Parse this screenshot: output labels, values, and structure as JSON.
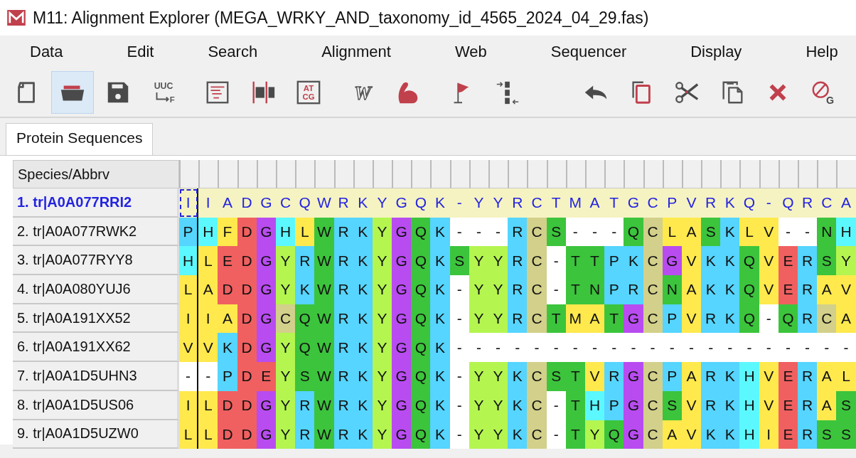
{
  "window": {
    "title": "M11: Alignment Explorer (MEGA_WRKY_AND_taxonomy_id_4565_2024_04_29.fas)"
  },
  "menu": [
    "Data",
    "Edit",
    "Search",
    "Alignment",
    "Web",
    "Sequencer",
    "Display",
    "Help"
  ],
  "toolbar": [
    [
      {
        "kind": "new",
        "active": false
      },
      {
        "kind": "open",
        "active": true
      },
      {
        "kind": "save",
        "active": false
      },
      {
        "kind": "translate",
        "active": false,
        "label": "UUC",
        "sublabel": "F"
      }
    ],
    [
      {
        "kind": "text",
        "active": false
      },
      {
        "kind": "split",
        "active": false
      },
      {
        "kind": "bases",
        "active": false,
        "label": "AT",
        "sublabel": "CG"
      }
    ],
    [
      {
        "kind": "wletter",
        "active": false,
        "label": "W"
      },
      {
        "kind": "arm",
        "active": false
      }
    ],
    [
      {
        "kind": "flag",
        "active": false
      },
      {
        "kind": "mark",
        "active": false
      },
      {
        "kind": "undo",
        "active": false
      },
      {
        "kind": "copy",
        "active": false
      },
      {
        "kind": "cut",
        "active": false
      },
      {
        "kind": "paste",
        "active": false
      },
      {
        "kind": "delete",
        "active": false
      },
      {
        "kind": "gaps",
        "active": false,
        "label": "G"
      }
    ]
  ],
  "tabs": [
    {
      "label": "Protein Sequences",
      "selected": true
    }
  ],
  "table": {
    "name_header": "Species/Abbrv",
    "rows": [
      {
        "name": "1. tr|A0A077RRI2",
        "selected": true,
        "cursor_at_start": true,
        "cells": [
          {
            "aa": "I"
          },
          {
            "aa": "I"
          },
          {
            "aa": "A"
          },
          {
            "aa": "D"
          },
          {
            "aa": "G"
          },
          {
            "aa": "C"
          },
          {
            "aa": "Q"
          },
          {
            "aa": "W"
          },
          {
            "aa": "R"
          },
          {
            "aa": "K"
          },
          {
            "aa": "Y"
          },
          {
            "aa": "G"
          },
          {
            "aa": "Q"
          },
          {
            "aa": "K"
          },
          {
            "aa": "-"
          },
          {
            "aa": "Y"
          },
          {
            "aa": "Y"
          },
          {
            "aa": "R"
          },
          {
            "aa": "C"
          },
          {
            "aa": "T"
          },
          {
            "aa": "M"
          },
          {
            "aa": "A"
          },
          {
            "aa": "T"
          },
          {
            "aa": "G"
          },
          {
            "aa": "C"
          },
          {
            "aa": "P"
          },
          {
            "aa": "V"
          },
          {
            "aa": "R"
          },
          {
            "aa": "K"
          },
          {
            "aa": "Q"
          },
          {
            "aa": "-"
          },
          {
            "aa": "Q"
          },
          {
            "aa": "R"
          },
          {
            "aa": "C"
          },
          {
            "aa": "A"
          }
        ]
      },
      {
        "name": "2. tr|A0A077RWK2",
        "selected": false,
        "cursor_at_start": false,
        "cells": [
          {
            "aa": "P",
            "color": "#55d5ff"
          },
          {
            "aa": "H",
            "color": "#5cf8ff"
          },
          {
            "aa": "F",
            "color": "#ffe94d"
          },
          {
            "aa": "D",
            "color": "#f06060"
          },
          {
            "aa": "G",
            "color": "#b84cf0"
          },
          {
            "aa": "H",
            "color": "#5cf8ff"
          },
          {
            "aa": "L",
            "color": "#ffe94d"
          },
          {
            "aa": "W",
            "color": "#3cc43c"
          },
          {
            "aa": "R",
            "color": "#55d5ff"
          },
          {
            "aa": "K",
            "color": "#55d5ff"
          },
          {
            "aa": "Y",
            "color": "#b4f550"
          },
          {
            "aa": "G",
            "color": "#b84cf0"
          },
          {
            "aa": "Q",
            "color": "#3cc43c"
          },
          {
            "aa": "K",
            "color": "#55d5ff"
          },
          {
            "aa": "-",
            "color": "#ffffff"
          },
          {
            "aa": "-",
            "color": "#ffffff"
          },
          {
            "aa": "-",
            "color": "#ffffff"
          },
          {
            "aa": "R",
            "color": "#55d5ff"
          },
          {
            "aa": "C",
            "color": "#d2d08a"
          },
          {
            "aa": "S",
            "color": "#3cc43c"
          },
          {
            "aa": "-",
            "color": "#ffffff"
          },
          {
            "aa": "-",
            "color": "#ffffff"
          },
          {
            "aa": "-",
            "color": "#ffffff"
          },
          {
            "aa": "Q",
            "color": "#3cc43c"
          },
          {
            "aa": "C",
            "color": "#d2d08a"
          },
          {
            "aa": "L",
            "color": "#ffe94d"
          },
          {
            "aa": "A",
            "color": "#ffe94d"
          },
          {
            "aa": "S",
            "color": "#3cc43c"
          },
          {
            "aa": "K",
            "color": "#55d5ff"
          },
          {
            "aa": "L",
            "color": "#ffe94d"
          },
          {
            "aa": "V",
            "color": "#ffe94d"
          },
          {
            "aa": "-",
            "color": "#ffffff"
          },
          {
            "aa": "-",
            "color": "#ffffff"
          },
          {
            "aa": "N",
            "color": "#3cc43c"
          },
          {
            "aa": "H",
            "color": "#5cf8ff"
          }
        ]
      },
      {
        "name": "3. tr|A0A077RYY8",
        "selected": false,
        "cursor_at_start": false,
        "cells": [
          {
            "aa": "H",
            "color": "#5cf8ff"
          },
          {
            "aa": "L",
            "color": "#ffe94d"
          },
          {
            "aa": "E",
            "color": "#f06060"
          },
          {
            "aa": "D",
            "color": "#f06060"
          },
          {
            "aa": "G",
            "color": "#b84cf0"
          },
          {
            "aa": "Y",
            "color": "#b4f550"
          },
          {
            "aa": "R",
            "color": "#55d5ff"
          },
          {
            "aa": "W",
            "color": "#3cc43c"
          },
          {
            "aa": "R",
            "color": "#55d5ff"
          },
          {
            "aa": "K",
            "color": "#55d5ff"
          },
          {
            "aa": "Y",
            "color": "#b4f550"
          },
          {
            "aa": "G",
            "color": "#b84cf0"
          },
          {
            "aa": "Q",
            "color": "#3cc43c"
          },
          {
            "aa": "K",
            "color": "#55d5ff"
          },
          {
            "aa": "S",
            "color": "#3cc43c"
          },
          {
            "aa": "Y",
            "color": "#b4f550"
          },
          {
            "aa": "Y",
            "color": "#b4f550"
          },
          {
            "aa": "R",
            "color": "#55d5ff"
          },
          {
            "aa": "C",
            "color": "#d2d08a"
          },
          {
            "aa": "-",
            "color": "#ffffff"
          },
          {
            "aa": "T",
            "color": "#3cc43c"
          },
          {
            "aa": "T",
            "color": "#3cc43c"
          },
          {
            "aa": "P",
            "color": "#55d5ff"
          },
          {
            "aa": "K",
            "color": "#55d5ff"
          },
          {
            "aa": "C",
            "color": "#d2d08a"
          },
          {
            "aa": "G",
            "color": "#b84cf0"
          },
          {
            "aa": "V",
            "color": "#ffe94d"
          },
          {
            "aa": "K",
            "color": "#55d5ff"
          },
          {
            "aa": "K",
            "color": "#55d5ff"
          },
          {
            "aa": "Q",
            "color": "#3cc43c"
          },
          {
            "aa": "V",
            "color": "#ffe94d"
          },
          {
            "aa": "E",
            "color": "#f06060"
          },
          {
            "aa": "R",
            "color": "#55d5ff"
          },
          {
            "aa": "S",
            "color": "#3cc43c"
          },
          {
            "aa": "Y",
            "color": "#b4f550"
          }
        ]
      },
      {
        "name": "4. tr|A0A080YUJ6",
        "selected": false,
        "cursor_at_start": false,
        "cells": [
          {
            "aa": "L",
            "color": "#ffe94d"
          },
          {
            "aa": "A",
            "color": "#ffe94d"
          },
          {
            "aa": "D",
            "color": "#f06060"
          },
          {
            "aa": "D",
            "color": "#f06060"
          },
          {
            "aa": "G",
            "color": "#b84cf0"
          },
          {
            "aa": "Y",
            "color": "#b4f550"
          },
          {
            "aa": "K",
            "color": "#55d5ff"
          },
          {
            "aa": "W",
            "color": "#3cc43c"
          },
          {
            "aa": "R",
            "color": "#55d5ff"
          },
          {
            "aa": "K",
            "color": "#55d5ff"
          },
          {
            "aa": "Y",
            "color": "#b4f550"
          },
          {
            "aa": "G",
            "color": "#b84cf0"
          },
          {
            "aa": "Q",
            "color": "#3cc43c"
          },
          {
            "aa": "K",
            "color": "#55d5ff"
          },
          {
            "aa": "-",
            "color": "#ffffff"
          },
          {
            "aa": "Y",
            "color": "#b4f550"
          },
          {
            "aa": "Y",
            "color": "#b4f550"
          },
          {
            "aa": "R",
            "color": "#55d5ff"
          },
          {
            "aa": "C",
            "color": "#d2d08a"
          },
          {
            "aa": "-",
            "color": "#ffffff"
          },
          {
            "aa": "T",
            "color": "#3cc43c"
          },
          {
            "aa": "N",
            "color": "#3cc43c"
          },
          {
            "aa": "P",
            "color": "#55d5ff"
          },
          {
            "aa": "R",
            "color": "#55d5ff"
          },
          {
            "aa": "C",
            "color": "#d2d08a"
          },
          {
            "aa": "N",
            "color": "#3cc43c"
          },
          {
            "aa": "A",
            "color": "#ffe94d"
          },
          {
            "aa": "K",
            "color": "#55d5ff"
          },
          {
            "aa": "K",
            "color": "#55d5ff"
          },
          {
            "aa": "Q",
            "color": "#3cc43c"
          },
          {
            "aa": "V",
            "color": "#ffe94d"
          },
          {
            "aa": "E",
            "color": "#f06060"
          },
          {
            "aa": "R",
            "color": "#55d5ff"
          },
          {
            "aa": "A",
            "color": "#ffe94d"
          },
          {
            "aa": "V",
            "color": "#ffe94d"
          }
        ]
      },
      {
        "name": "5. tr|A0A191XX52",
        "selected": false,
        "cursor_at_start": false,
        "cells": [
          {
            "aa": "I",
            "color": "#ffe94d"
          },
          {
            "aa": "I",
            "color": "#ffe94d"
          },
          {
            "aa": "A",
            "color": "#ffe94d"
          },
          {
            "aa": "D",
            "color": "#f06060"
          },
          {
            "aa": "G",
            "color": "#b84cf0"
          },
          {
            "aa": "C",
            "color": "#d2d08a"
          },
          {
            "aa": "Q",
            "color": "#3cc43c"
          },
          {
            "aa": "W",
            "color": "#3cc43c"
          },
          {
            "aa": "R",
            "color": "#55d5ff"
          },
          {
            "aa": "K",
            "color": "#55d5ff"
          },
          {
            "aa": "Y",
            "color": "#b4f550"
          },
          {
            "aa": "G",
            "color": "#b84cf0"
          },
          {
            "aa": "Q",
            "color": "#3cc43c"
          },
          {
            "aa": "K",
            "color": "#55d5ff"
          },
          {
            "aa": "-",
            "color": "#ffffff"
          },
          {
            "aa": "Y",
            "color": "#b4f550"
          },
          {
            "aa": "Y",
            "color": "#b4f550"
          },
          {
            "aa": "R",
            "color": "#55d5ff"
          },
          {
            "aa": "C",
            "color": "#d2d08a"
          },
          {
            "aa": "T",
            "color": "#3cc43c"
          },
          {
            "aa": "M",
            "color": "#ffe94d"
          },
          {
            "aa": "A",
            "color": "#ffe94d"
          },
          {
            "aa": "T",
            "color": "#3cc43c"
          },
          {
            "aa": "G",
            "color": "#b84cf0"
          },
          {
            "aa": "C",
            "color": "#d2d08a"
          },
          {
            "aa": "P",
            "color": "#55d5ff"
          },
          {
            "aa": "V",
            "color": "#ffe94d"
          },
          {
            "aa": "R",
            "color": "#55d5ff"
          },
          {
            "aa": "K",
            "color": "#55d5ff"
          },
          {
            "aa": "Q",
            "color": "#3cc43c"
          },
          {
            "aa": "-",
            "color": "#ffffff"
          },
          {
            "aa": "Q",
            "color": "#3cc43c"
          },
          {
            "aa": "R",
            "color": "#55d5ff"
          },
          {
            "aa": "C",
            "color": "#d2d08a"
          },
          {
            "aa": "A",
            "color": "#ffe94d"
          }
        ]
      },
      {
        "name": "6. tr|A0A191XX62",
        "selected": false,
        "cursor_at_start": false,
        "cells": [
          {
            "aa": "V",
            "color": "#ffe94d"
          },
          {
            "aa": "V",
            "color": "#ffe94d"
          },
          {
            "aa": "K",
            "color": "#55d5ff"
          },
          {
            "aa": "D",
            "color": "#f06060"
          },
          {
            "aa": "G",
            "color": "#b84cf0"
          },
          {
            "aa": "Y",
            "color": "#b4f550"
          },
          {
            "aa": "Q",
            "color": "#3cc43c"
          },
          {
            "aa": "W",
            "color": "#3cc43c"
          },
          {
            "aa": "R",
            "color": "#55d5ff"
          },
          {
            "aa": "K",
            "color": "#55d5ff"
          },
          {
            "aa": "Y",
            "color": "#b4f550"
          },
          {
            "aa": "G",
            "color": "#b84cf0"
          },
          {
            "aa": "Q",
            "color": "#3cc43c"
          },
          {
            "aa": "K",
            "color": "#55d5ff"
          },
          {
            "aa": "-",
            "color": "#ffffff"
          },
          {
            "aa": "-",
            "color": "#ffffff"
          },
          {
            "aa": "-",
            "color": "#ffffff"
          },
          {
            "aa": "-",
            "color": "#ffffff"
          },
          {
            "aa": "-",
            "color": "#ffffff"
          },
          {
            "aa": "-",
            "color": "#ffffff"
          },
          {
            "aa": "-",
            "color": "#ffffff"
          },
          {
            "aa": "-",
            "color": "#ffffff"
          },
          {
            "aa": "-",
            "color": "#ffffff"
          },
          {
            "aa": "-",
            "color": "#ffffff"
          },
          {
            "aa": "-",
            "color": "#ffffff"
          },
          {
            "aa": "-",
            "color": "#ffffff"
          },
          {
            "aa": "-",
            "color": "#ffffff"
          },
          {
            "aa": "-",
            "color": "#ffffff"
          },
          {
            "aa": "-",
            "color": "#ffffff"
          },
          {
            "aa": "-",
            "color": "#ffffff"
          },
          {
            "aa": "-",
            "color": "#ffffff"
          },
          {
            "aa": "-",
            "color": "#ffffff"
          },
          {
            "aa": "-",
            "color": "#ffffff"
          },
          {
            "aa": "-",
            "color": "#ffffff"
          },
          {
            "aa": "-",
            "color": "#ffffff"
          }
        ]
      },
      {
        "name": "7. tr|A0A1D5UHN3",
        "selected": false,
        "cursor_at_start": false,
        "cells": [
          {
            "aa": "-",
            "color": "#ffffff"
          },
          {
            "aa": "-",
            "color": "#ffffff"
          },
          {
            "aa": "P",
            "color": "#55d5ff"
          },
          {
            "aa": "D",
            "color": "#f06060"
          },
          {
            "aa": "E",
            "color": "#f06060"
          },
          {
            "aa": "Y",
            "color": "#b4f550"
          },
          {
            "aa": "S",
            "color": "#3cc43c"
          },
          {
            "aa": "W",
            "color": "#3cc43c"
          },
          {
            "aa": "R",
            "color": "#55d5ff"
          },
          {
            "aa": "K",
            "color": "#55d5ff"
          },
          {
            "aa": "Y",
            "color": "#b4f550"
          },
          {
            "aa": "G",
            "color": "#b84cf0"
          },
          {
            "aa": "Q",
            "color": "#3cc43c"
          },
          {
            "aa": "K",
            "color": "#55d5ff"
          },
          {
            "aa": "-",
            "color": "#ffffff"
          },
          {
            "aa": "Y",
            "color": "#b4f550"
          },
          {
            "aa": "Y",
            "color": "#b4f550"
          },
          {
            "aa": "K",
            "color": "#55d5ff"
          },
          {
            "aa": "C",
            "color": "#d2d08a"
          },
          {
            "aa": "S",
            "color": "#3cc43c"
          },
          {
            "aa": "T",
            "color": "#3cc43c"
          },
          {
            "aa": "V",
            "color": "#ffe94d"
          },
          {
            "aa": "R",
            "color": "#55d5ff"
          },
          {
            "aa": "G",
            "color": "#b84cf0"
          },
          {
            "aa": "C",
            "color": "#d2d08a"
          },
          {
            "aa": "P",
            "color": "#55d5ff"
          },
          {
            "aa": "A",
            "color": "#ffe94d"
          },
          {
            "aa": "R",
            "color": "#55d5ff"
          },
          {
            "aa": "K",
            "color": "#55d5ff"
          },
          {
            "aa": "H",
            "color": "#5cf8ff"
          },
          {
            "aa": "V",
            "color": "#ffe94d"
          },
          {
            "aa": "E",
            "color": "#f06060"
          },
          {
            "aa": "R",
            "color": "#55d5ff"
          },
          {
            "aa": "A",
            "color": "#ffe94d"
          },
          {
            "aa": "L",
            "color": "#ffe94d"
          }
        ]
      },
      {
        "name": "8. tr|A0A1D5US06",
        "selected": false,
        "cursor_at_start": false,
        "cells": [
          {
            "aa": "I",
            "color": "#ffe94d"
          },
          {
            "aa": "L",
            "color": "#ffe94d"
          },
          {
            "aa": "D",
            "color": "#f06060"
          },
          {
            "aa": "D",
            "color": "#f06060"
          },
          {
            "aa": "G",
            "color": "#b84cf0"
          },
          {
            "aa": "Y",
            "color": "#b4f550"
          },
          {
            "aa": "R",
            "color": "#55d5ff"
          },
          {
            "aa": "W",
            "color": "#3cc43c"
          },
          {
            "aa": "R",
            "color": "#55d5ff"
          },
          {
            "aa": "K",
            "color": "#55d5ff"
          },
          {
            "aa": "Y",
            "color": "#b4f550"
          },
          {
            "aa": "G",
            "color": "#b84cf0"
          },
          {
            "aa": "Q",
            "color": "#3cc43c"
          },
          {
            "aa": "K",
            "color": "#55d5ff"
          },
          {
            "aa": "-",
            "color": "#ffffff"
          },
          {
            "aa": "Y",
            "color": "#b4f550"
          },
          {
            "aa": "Y",
            "color": "#b4f550"
          },
          {
            "aa": "K",
            "color": "#55d5ff"
          },
          {
            "aa": "C",
            "color": "#d2d08a"
          },
          {
            "aa": "-",
            "color": "#ffffff"
          },
          {
            "aa": "T",
            "color": "#3cc43c"
          },
          {
            "aa": "H",
            "color": "#5cf8ff"
          },
          {
            "aa": "P",
            "color": "#55d5ff"
          },
          {
            "aa": "G",
            "color": "#b84cf0"
          },
          {
            "aa": "C",
            "color": "#d2d08a"
          },
          {
            "aa": "S",
            "color": "#3cc43c"
          },
          {
            "aa": "V",
            "color": "#ffe94d"
          },
          {
            "aa": "R",
            "color": "#55d5ff"
          },
          {
            "aa": "K",
            "color": "#55d5ff"
          },
          {
            "aa": "H",
            "color": "#5cf8ff"
          },
          {
            "aa": "V",
            "color": "#ffe94d"
          },
          {
            "aa": "E",
            "color": "#f06060"
          },
          {
            "aa": "R",
            "color": "#55d5ff"
          },
          {
            "aa": "A",
            "color": "#ffe94d"
          },
          {
            "aa": "S",
            "color": "#3cc43c"
          }
        ]
      },
      {
        "name": "9. tr|A0A1D5UZW0",
        "selected": false,
        "cursor_at_start": false,
        "cells": [
          {
            "aa": "L",
            "color": "#ffe94d"
          },
          {
            "aa": "L",
            "color": "#ffe94d"
          },
          {
            "aa": "D",
            "color": "#f06060"
          },
          {
            "aa": "D",
            "color": "#f06060"
          },
          {
            "aa": "G",
            "color": "#b84cf0"
          },
          {
            "aa": "Y",
            "color": "#b4f550"
          },
          {
            "aa": "R",
            "color": "#55d5ff"
          },
          {
            "aa": "W",
            "color": "#3cc43c"
          },
          {
            "aa": "R",
            "color": "#55d5ff"
          },
          {
            "aa": "K",
            "color": "#55d5ff"
          },
          {
            "aa": "Y",
            "color": "#b4f550"
          },
          {
            "aa": "G",
            "color": "#b84cf0"
          },
          {
            "aa": "Q",
            "color": "#3cc43c"
          },
          {
            "aa": "K",
            "color": "#55d5ff"
          },
          {
            "aa": "-",
            "color": "#ffffff"
          },
          {
            "aa": "Y",
            "color": "#b4f550"
          },
          {
            "aa": "Y",
            "color": "#b4f550"
          },
          {
            "aa": "K",
            "color": "#55d5ff"
          },
          {
            "aa": "C",
            "color": "#d2d08a"
          },
          {
            "aa": "-",
            "color": "#ffffff"
          },
          {
            "aa": "T",
            "color": "#3cc43c"
          },
          {
            "aa": "Y",
            "color": "#b4f550"
          },
          {
            "aa": "Q",
            "color": "#3cc43c"
          },
          {
            "aa": "G",
            "color": "#b84cf0"
          },
          {
            "aa": "C",
            "color": "#d2d08a"
          },
          {
            "aa": "A",
            "color": "#ffe94d"
          },
          {
            "aa": "V",
            "color": "#ffe94d"
          },
          {
            "aa": "K",
            "color": "#55d5ff"
          },
          {
            "aa": "K",
            "color": "#55d5ff"
          },
          {
            "aa": "H",
            "color": "#5cf8ff"
          },
          {
            "aa": "I",
            "color": "#ffe94d"
          },
          {
            "aa": "E",
            "color": "#f06060"
          },
          {
            "aa": "R",
            "color": "#55d5ff"
          },
          {
            "aa": "S",
            "color": "#3cc43c"
          },
          {
            "aa": "S",
            "color": "#3cc43c"
          }
        ]
      }
    ]
  }
}
